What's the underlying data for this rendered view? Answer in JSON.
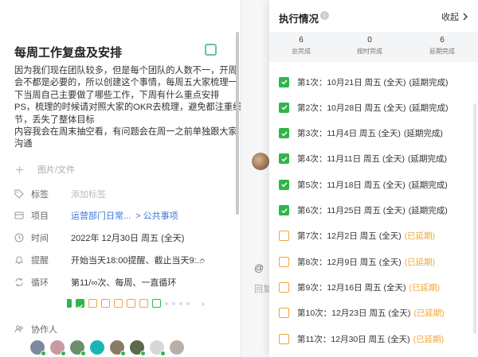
{
  "task": {
    "title": "每周工作复盘及安排",
    "description_lines": [
      "因为我们现在团队较多，但是每个团队的人数不一，开周",
      "会不都是必要的，所以创建这个事情，每周五大家梳理一",
      "下当周自己主要做了哪些工作，下周有什么重点安排",
      "PS，梳理的时候请对照大家的OKR去梳理，避免都注重细",
      "节，丢失了整体目标",
      "内容我会在周末抽空看，有问题会在周一之前单独跟大家",
      "沟通"
    ],
    "attachment_label": "图片/文件",
    "fields": {
      "tag": {
        "label": "标签",
        "value": "添加标签"
      },
      "project": {
        "label": "项目",
        "value_a": "运营部门日常...",
        "value_b": "> 公共事项"
      },
      "time": {
        "label": "时间",
        "value": "2022年 12月30日 周五 (全天)"
      },
      "reminder": {
        "label": "提醒",
        "value": "开始当天18:00提醒、截止当天9:..."
      },
      "repeat": {
        "label": "循环",
        "value": "第11/∞次、每周、一直循环"
      }
    },
    "collaborators_label": "协作人",
    "avatar_icons": [
      "avatar-1",
      "avatar-2",
      "avatar-3",
      "avatar-4",
      "avatar-5",
      "avatar-6",
      "avatar-7",
      "avatar-8"
    ],
    "avatar_colors": [
      "#7a8aa0",
      "#c99aa0",
      "#6b8f6b",
      "#19b6b8",
      "#8a7a6a",
      "#5a6a4a",
      "#d7d7d7",
      "#b8b0a8"
    ]
  },
  "middle": {
    "at_symbol": "@",
    "reply_label": "回复"
  },
  "execution": {
    "title": "执行情况",
    "collapse_label": "收起",
    "stats": [
      {
        "value": "6",
        "label": "总完成"
      },
      {
        "value": "0",
        "label": "按时完成"
      },
      {
        "value": "6",
        "label": "延期完成"
      }
    ],
    "occurrences": [
      {
        "label": "第1次：10月21日 周五 (全天)",
        "status": "(延期完成)",
        "done": true
      },
      {
        "label": "第2次：10月28日 周五 (全天)",
        "status": "(延期完成)",
        "done": true
      },
      {
        "label": "第3次：11月4日 周五 (全天)",
        "status": "(延期完成)",
        "done": true
      },
      {
        "label": "第4次：11月11日 周五 (全天)",
        "status": "(延期完成)",
        "done": true
      },
      {
        "label": "第5次：11月18日 周五 (全天)",
        "status": "(延期完成)",
        "done": true
      },
      {
        "label": "第6次：11月25日 周五 (全天)",
        "status": "(延期完成)",
        "done": true
      },
      {
        "label": "第7次：12月2日 周五 (全天)",
        "status": "(已延期)",
        "done": false
      },
      {
        "label": "第8次：12月9日 周五 (全天)",
        "status": "(已延期)",
        "done": false
      },
      {
        "label": "第9次：12月16日 周五 (全天)",
        "status": "(已延期)",
        "done": false
      },
      {
        "label": "第10次：12月23日 周五 (全天)",
        "status": "(已延期)",
        "done": false
      },
      {
        "label": "第11次：12月30日 周五 (全天)",
        "status": "(已延期)",
        "done": false
      }
    ]
  },
  "colors": {
    "done_green": "#2fb54a",
    "overdue_orange": "#f0a73a",
    "link_blue": "#3b78d8",
    "accent_teal": "#5fc3b3"
  }
}
